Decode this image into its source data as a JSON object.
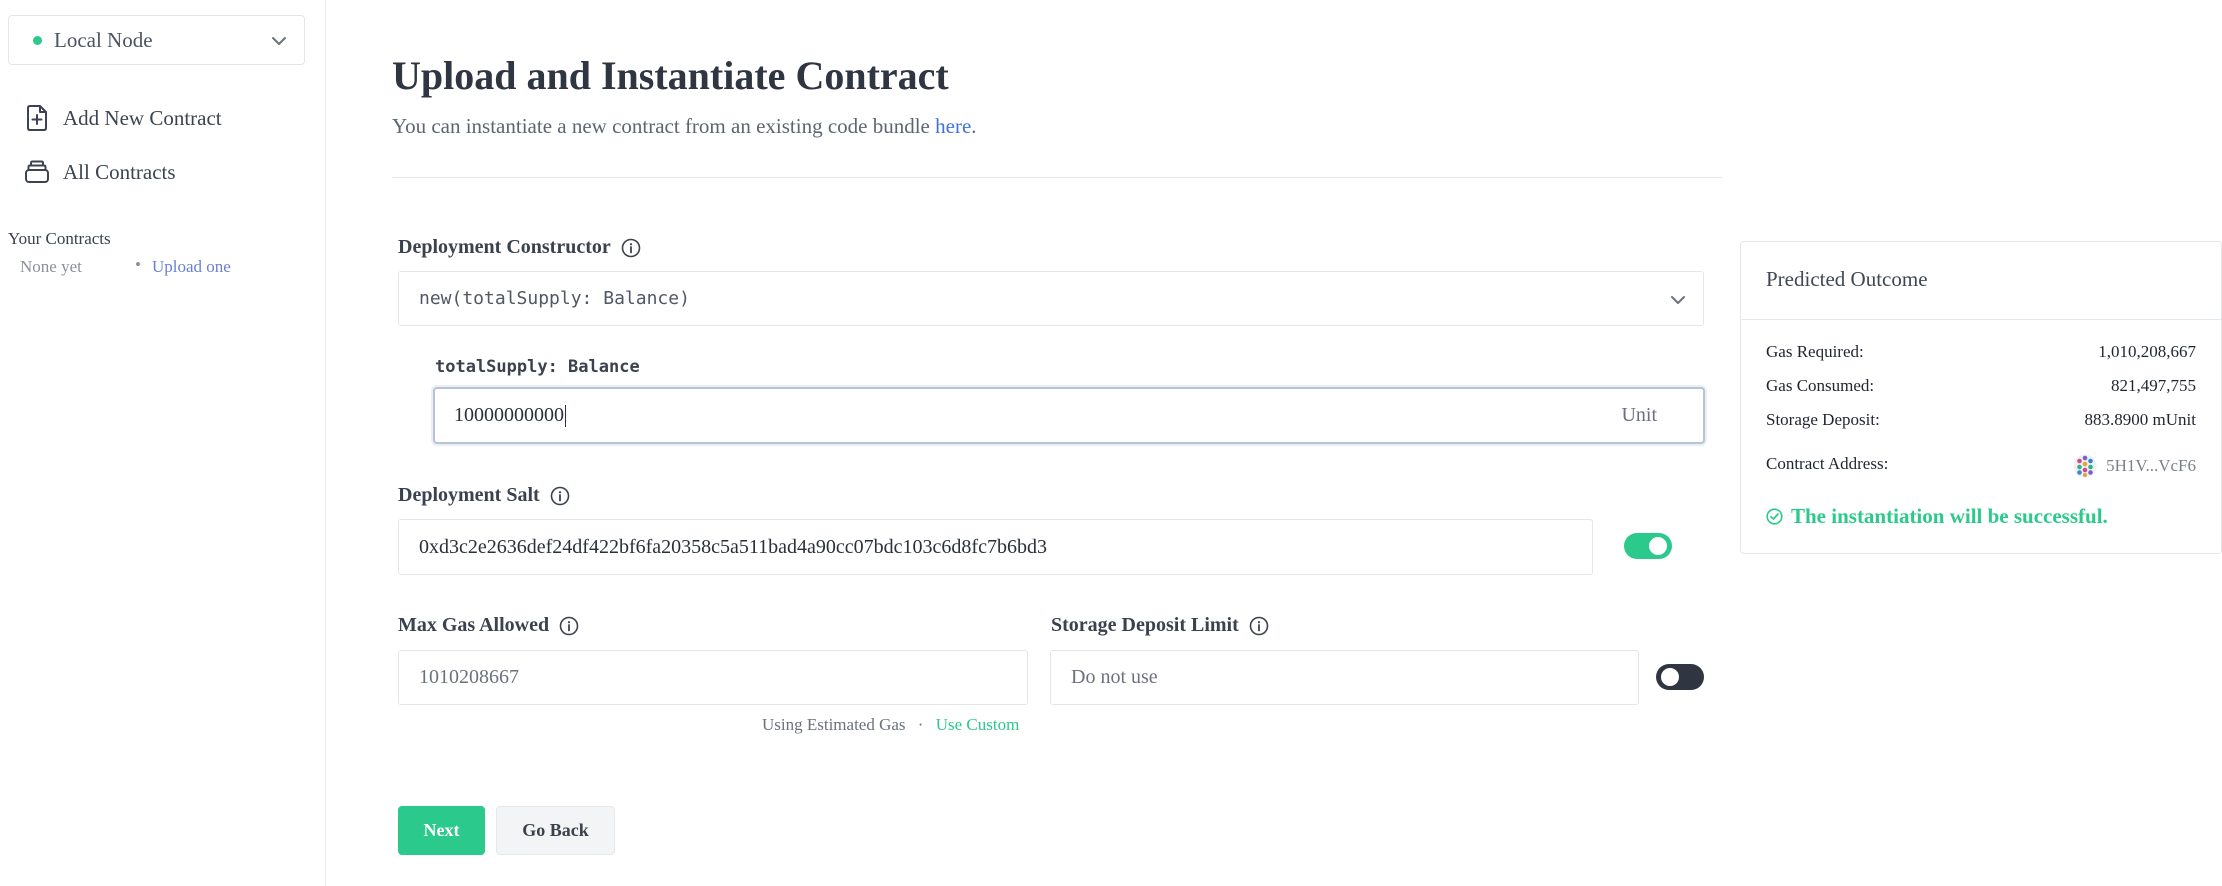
{
  "sidebar": {
    "network": {
      "label": "Local Node",
      "status_color": "#2cc98c"
    },
    "nav": [
      {
        "label": "Add New Contract",
        "icon": "file-plus-icon"
      },
      {
        "label": "All Contracts",
        "icon": "stack-icon"
      }
    ],
    "your_contracts": {
      "title": "Your Contracts",
      "empty_text": "None yet",
      "separator": "•",
      "upload_link": "Upload one"
    }
  },
  "header": {
    "title": "Upload and Instantiate Contract",
    "subtitle_prefix": "You can instantiate a new contract from an existing code bundle ",
    "subtitle_link": "here",
    "subtitle_suffix": "."
  },
  "form": {
    "constructor": {
      "label": "Deployment Constructor",
      "value": "new(totalSupply: Balance)"
    },
    "param": {
      "label": "totalSupply: Balance",
      "value": "10000000000",
      "unit": "Unit"
    },
    "salt": {
      "label": "Deployment Salt",
      "value": "0xd3c2e2636def24df422bf6fa20358c5a511bad4a90cc07bdc103c6d8fc7b6bd3",
      "enabled": true
    },
    "max_gas": {
      "label": "Max Gas Allowed",
      "value": "1010208667",
      "hint": "Using Estimated Gas",
      "hint_sep": "·",
      "hint_link": "Use Custom"
    },
    "storage_limit": {
      "label": "Storage Deposit Limit",
      "placeholder": "Do not use",
      "enabled": false
    },
    "buttons": {
      "next": "Next",
      "back": "Go Back"
    }
  },
  "outcome": {
    "title": "Predicted Outcome",
    "gas_required": {
      "label": "Gas Required:",
      "value": "1,010,208,667"
    },
    "gas_consumed": {
      "label": "Gas Consumed:",
      "value": "821,497,755"
    },
    "storage_deposit": {
      "label": "Storage Deposit:",
      "value": "883.8900 mUnit"
    },
    "contract_address": {
      "label": "Contract Address:",
      "value": "5H1V...VcF6"
    },
    "success_message": "The instantiation will be successful."
  },
  "colors": {
    "accent": "#2cc98c",
    "link": "#3f73d8",
    "text": "#3a424e"
  }
}
